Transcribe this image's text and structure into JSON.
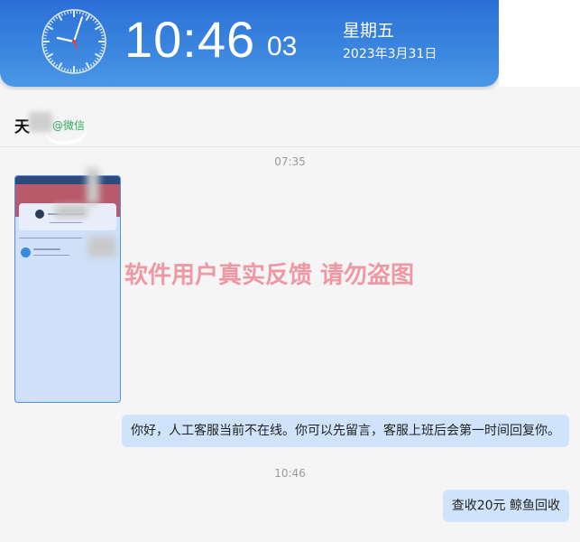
{
  "clock": {
    "time": "10:46",
    "seconds": "03",
    "weekday": "星期五",
    "date": "2023年3月31日"
  },
  "chat": {
    "contact_name": "天",
    "contact_source": "@微信",
    "messages": [
      {
        "type": "timestamp",
        "text": "07:35"
      },
      {
        "type": "image",
        "sender": "contact"
      },
      {
        "type": "text",
        "sender": "me",
        "text": "你好，人工客服当前不在线。你可以先留言，客服上班后会第一时间回复你。"
      },
      {
        "type": "timestamp",
        "text": "10:46"
      },
      {
        "type": "text",
        "sender": "me",
        "text": "查收20元  鲸鱼回收"
      }
    ]
  },
  "watermark": "软件用户真实反馈  请勿盗图",
  "colors": {
    "banner": "#3a85de",
    "bubble": "#cfe4fb",
    "wechat_green": "#2faa5a",
    "watermark": "#e86070"
  }
}
